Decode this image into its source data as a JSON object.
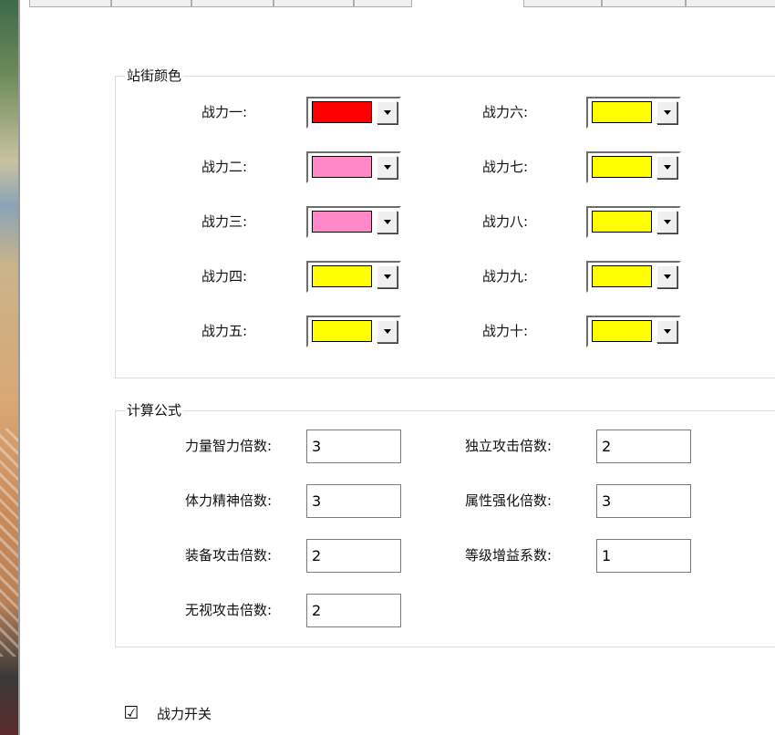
{
  "tabs": [
    "",
    "",
    "",
    "",
    "",
    "",
    "",
    ""
  ],
  "standing_colors": {
    "title": "站街颜色",
    "items": [
      {
        "label": "战力一:",
        "color": "#ff0000"
      },
      {
        "label": "战力二:",
        "color": "#ff88c8"
      },
      {
        "label": "战力三:",
        "color": "#ff88c8"
      },
      {
        "label": "战力四:",
        "color": "#ffff00"
      },
      {
        "label": "战力五:",
        "color": "#ffff00"
      },
      {
        "label": "战力六:",
        "color": "#ffff00"
      },
      {
        "label": "战力七:",
        "color": "#ffff00"
      },
      {
        "label": "战力八:",
        "color": "#ffff00"
      },
      {
        "label": "战力九:",
        "color": "#ffff00"
      },
      {
        "label": "战力十:",
        "color": "#ffff00"
      }
    ]
  },
  "formula": {
    "title": "计算公式",
    "fields": [
      {
        "label": "力量智力倍数:",
        "value": "3"
      },
      {
        "label": "体力精神倍数:",
        "value": "3"
      },
      {
        "label": "装备攻击倍数:",
        "value": "2"
      },
      {
        "label": "无视攻击倍数:",
        "value": "2"
      },
      {
        "label": "独立攻击倍数:",
        "value": "2"
      },
      {
        "label": "属性强化倍数:",
        "value": "3"
      },
      {
        "label": "等级增益系数:",
        "value": "1"
      }
    ]
  },
  "power_switch": {
    "label": "战力开关",
    "checked": true,
    "mark": "☑"
  }
}
